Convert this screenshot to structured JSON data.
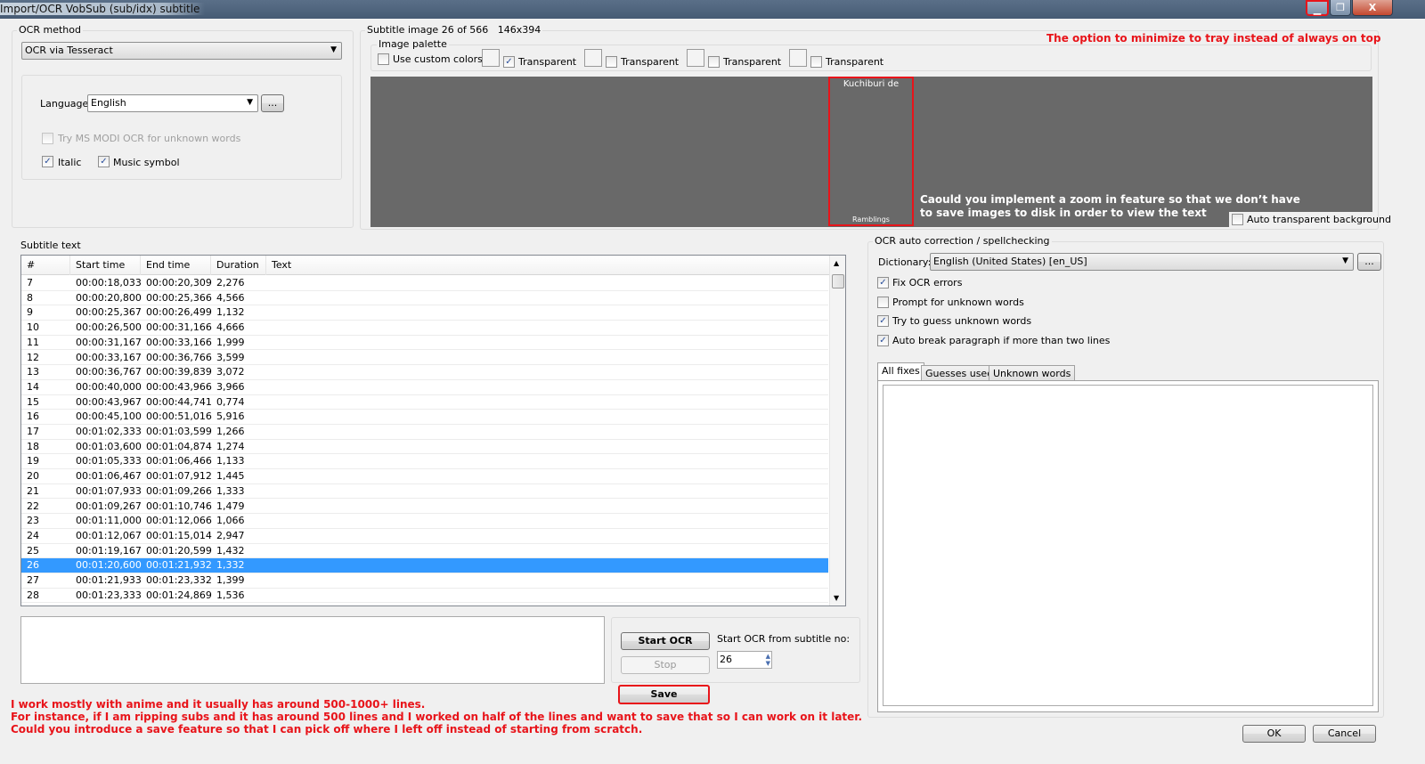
{
  "window": {
    "title": "Import/OCR VobSub (sub/idx) subtitle",
    "minimize_icon": "minimize-icon",
    "restore_icon": "restore-icon",
    "close_icon": "close-icon",
    "close_glyph": "X",
    "accent_red": "#e8141a",
    "selection_blue": "#3399ff"
  },
  "ocr_method": {
    "label": "OCR method",
    "selected": "OCR via Tesseract",
    "language_label": "Language",
    "language": "English",
    "browse": "...",
    "try_modi": "Try MS MODI OCR for unknown words",
    "try_modi_checked": false,
    "italic": "Italic",
    "italic_checked": true,
    "music": "Music symbol",
    "music_checked": true
  },
  "subtitle_image": {
    "label": "Subtitle image 26 of 566   146x394",
    "palette_label": "Image palette",
    "use_custom": "Use custom colors",
    "use_custom_checked": false,
    "transparent": [
      {
        "label": "Transparent",
        "checked": true
      },
      {
        "label": "Transparent",
        "checked": false
      },
      {
        "label": "Transparent",
        "checked": false
      },
      {
        "label": "Transparent",
        "checked": false
      }
    ],
    "image_top_text": "Kuchiburi de",
    "image_bottom_text": "Ramblings",
    "auto_transparent": "Auto transparent background",
    "auto_transparent_checked": false
  },
  "annotations": {
    "tray": "The option to minimize to tray instead of always on  top",
    "zoom_line1": "Caould you implement a zoom in feature so that we don’t have",
    "zoom_line2": "to save images to disk in order to view the text",
    "save_line1": "I work mostly with anime and it usually has around 500-1000+ lines.",
    "save_line2": "For instance, if I am ripping subs and it has around 500 lines and I worked on half of the lines and want to save that so I can work on it later.",
    "save_line3": "Could you introduce a save feature so that I can pick off where I left off instead of starting from scratch."
  },
  "subtitle_text": {
    "label": "Subtitle text",
    "columns": [
      "#",
      "Start time",
      "End time",
      "Duration",
      "Text"
    ],
    "selected_number": "26",
    "rows": [
      [
        "7",
        "00:00:18,033",
        "00:00:20,309",
        "2,276",
        ""
      ],
      [
        "8",
        "00:00:20,800",
        "00:00:25,366",
        "4,566",
        ""
      ],
      [
        "9",
        "00:00:25,367",
        "00:00:26,499",
        "1,132",
        ""
      ],
      [
        "10",
        "00:00:26,500",
        "00:00:31,166",
        "4,666",
        ""
      ],
      [
        "11",
        "00:00:31,167",
        "00:00:33,166",
        "1,999",
        ""
      ],
      [
        "12",
        "00:00:33,167",
        "00:00:36,766",
        "3,599",
        ""
      ],
      [
        "13",
        "00:00:36,767",
        "00:00:39,839",
        "3,072",
        ""
      ],
      [
        "14",
        "00:00:40,000",
        "00:00:43,966",
        "3,966",
        ""
      ],
      [
        "15",
        "00:00:43,967",
        "00:00:44,741",
        "0,774",
        ""
      ],
      [
        "16",
        "00:00:45,100",
        "00:00:51,016",
        "5,916",
        ""
      ],
      [
        "17",
        "00:01:02,333",
        "00:01:03,599",
        "1,266",
        ""
      ],
      [
        "18",
        "00:01:03,600",
        "00:01:04,874",
        "1,274",
        ""
      ],
      [
        "19",
        "00:01:05,333",
        "00:01:06,466",
        "1,133",
        ""
      ],
      [
        "20",
        "00:01:06,467",
        "00:01:07,912",
        "1,445",
        ""
      ],
      [
        "21",
        "00:01:07,933",
        "00:01:09,266",
        "1,333",
        ""
      ],
      [
        "22",
        "00:01:09,267",
        "00:01:10,746",
        "1,479",
        ""
      ],
      [
        "23",
        "00:01:11,000",
        "00:01:12,066",
        "1,066",
        ""
      ],
      [
        "24",
        "00:01:12,067",
        "00:01:15,014",
        "2,947",
        ""
      ],
      [
        "25",
        "00:01:19,167",
        "00:01:20,599",
        "1,432",
        ""
      ],
      [
        "26",
        "00:01:20,600",
        "00:01:21,932",
        "1,332",
        ""
      ],
      [
        "27",
        "00:01:21,933",
        "00:01:23,332",
        "1,399",
        ""
      ],
      [
        "28",
        "00:01:23,333",
        "00:01:24,869",
        "1,536",
        ""
      ]
    ]
  },
  "controls": {
    "start_ocr": "Start OCR",
    "stop": "Stop",
    "start_from_label": "Start OCR from subtitle no:",
    "start_from_value": "26",
    "save": "Save"
  },
  "autocorrect": {
    "label": "OCR auto correction / spellchecking",
    "dictionary_label": "Dictionary:",
    "dictionary": "English (United States) [en_US]",
    "browse": "...",
    "options": [
      {
        "label": "Fix OCR errors",
        "checked": true
      },
      {
        "label": "Prompt for unknown words",
        "checked": false
      },
      {
        "label": "Try to guess unknown words",
        "checked": true
      },
      {
        "label": "Auto break paragraph if more than two lines",
        "checked": true
      }
    ],
    "tabs": [
      "All fixes",
      "Guesses used",
      "Unknown words"
    ],
    "active_tab": "All fixes"
  },
  "footer": {
    "ok": "OK",
    "cancel": "Cancel"
  }
}
